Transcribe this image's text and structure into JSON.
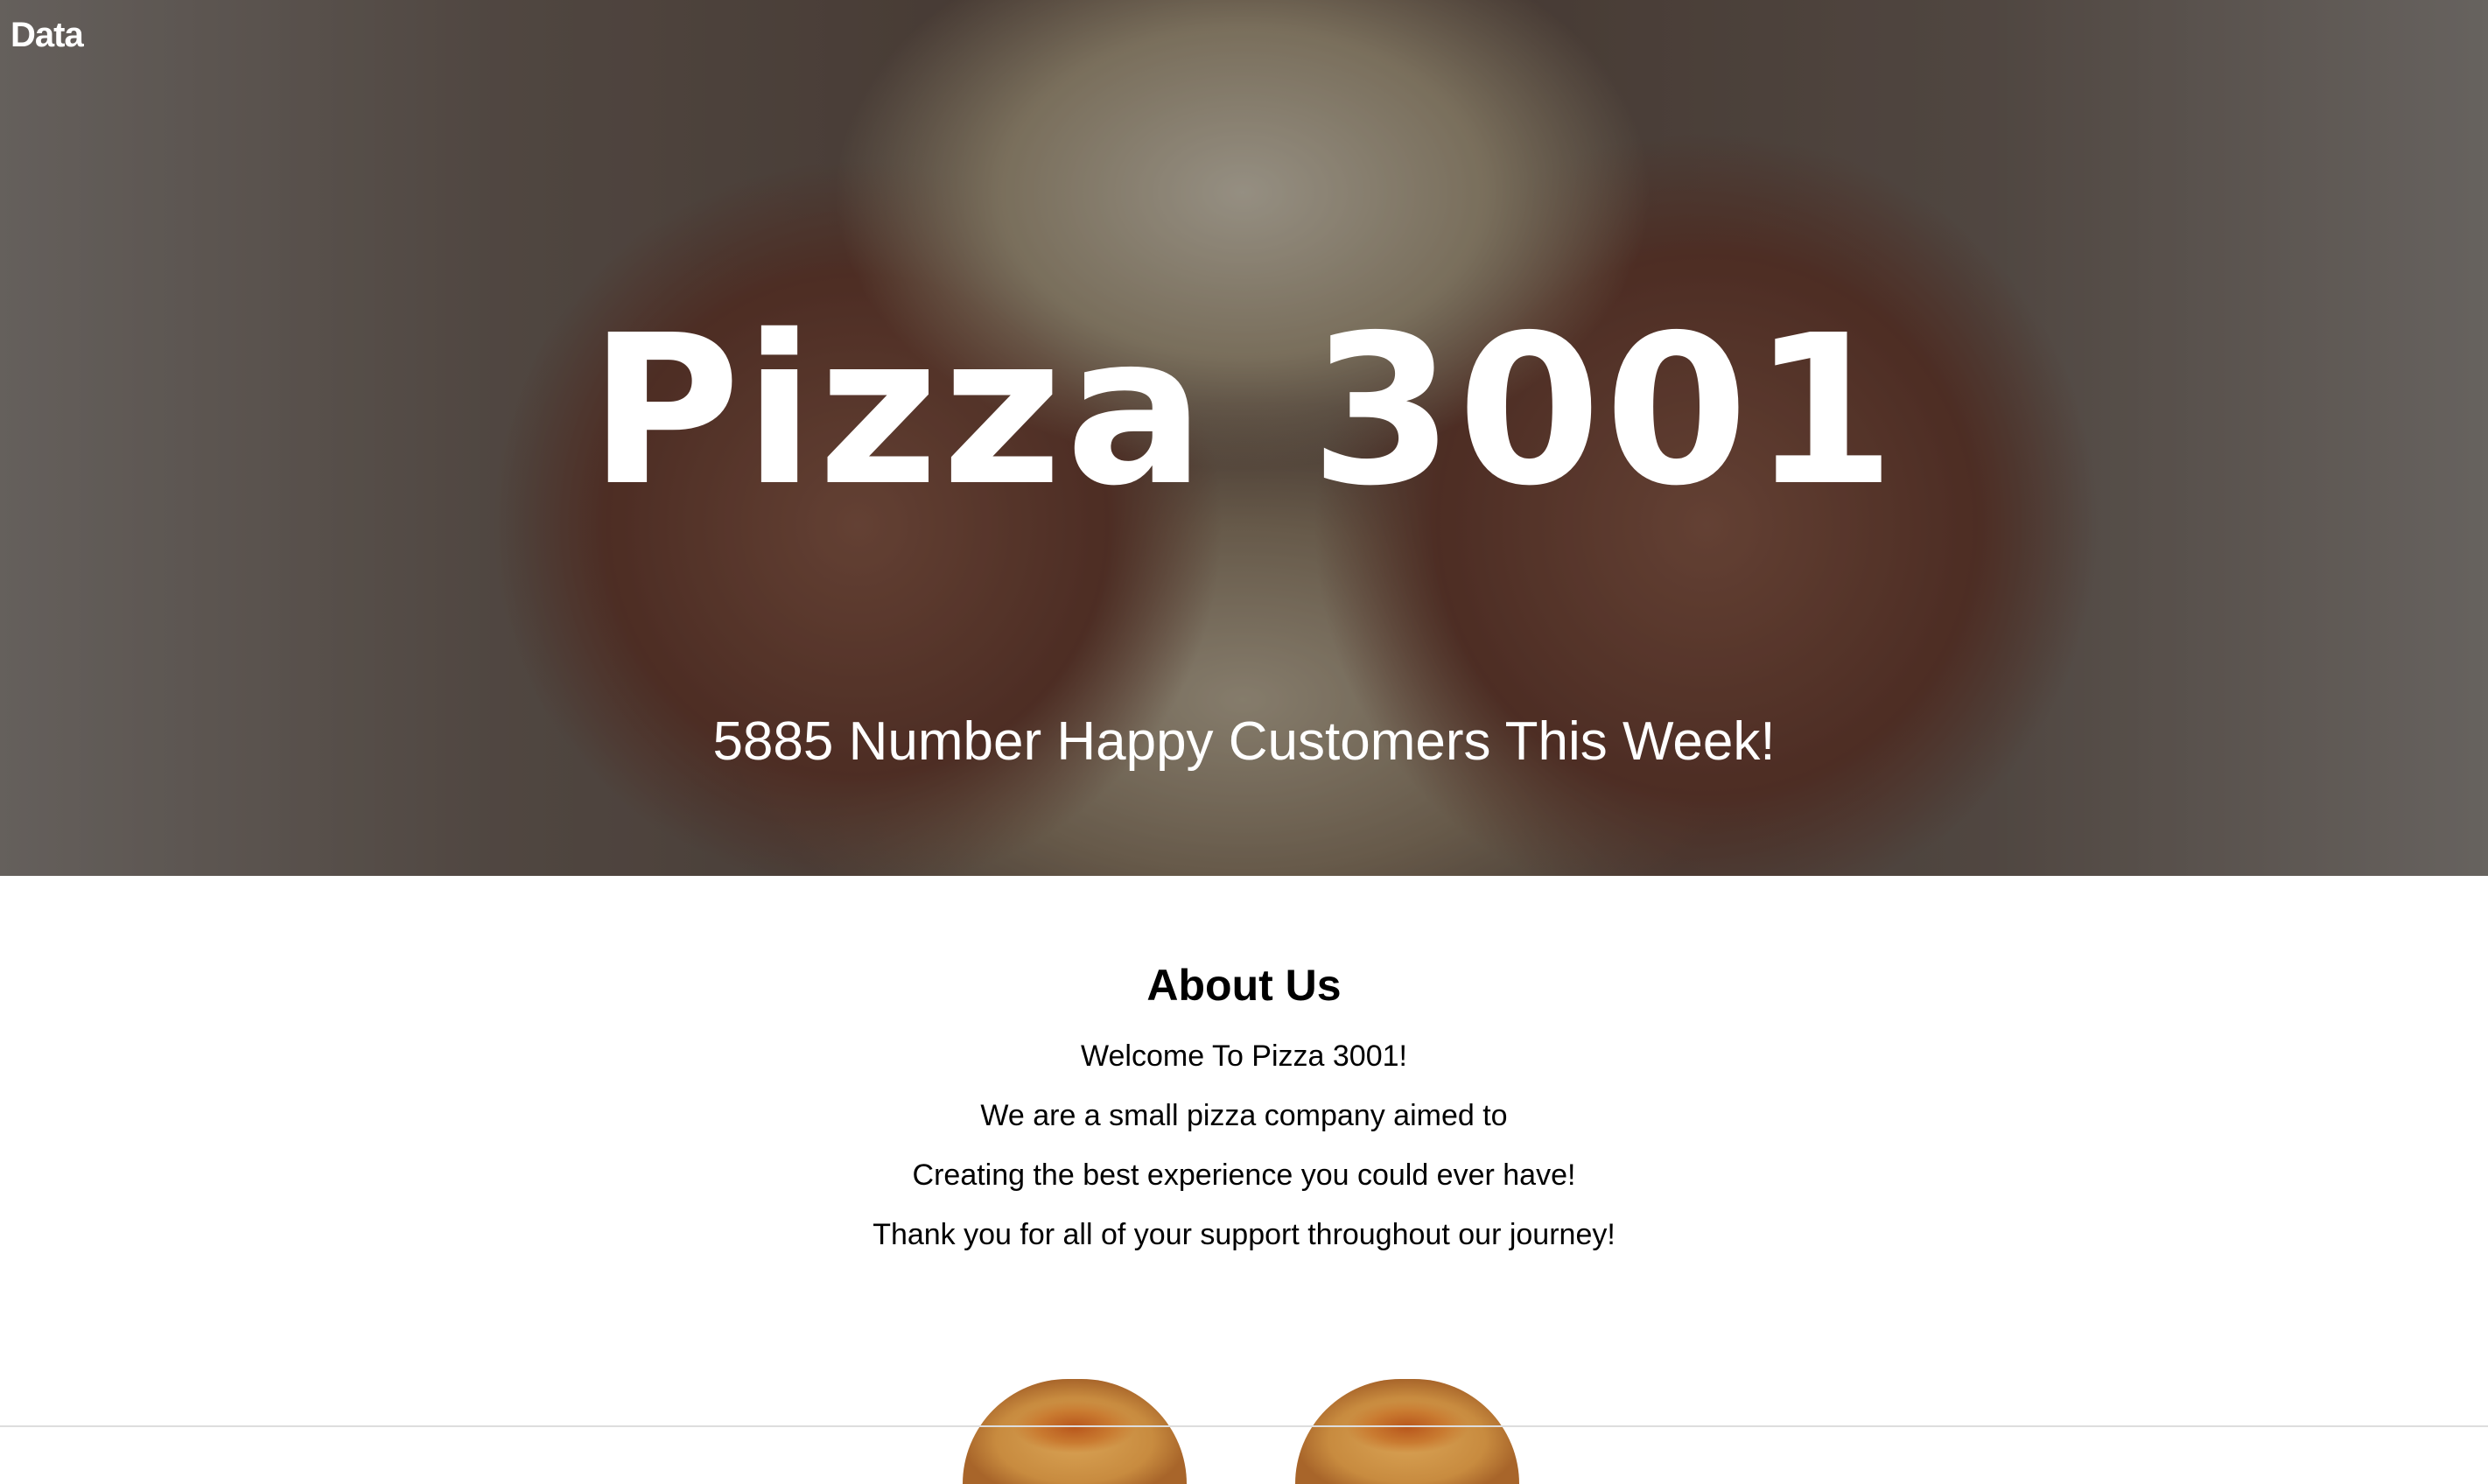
{
  "nav": {
    "brand": "Data"
  },
  "hero": {
    "title": "Pizza 3001",
    "subtitle": "5885 Number Happy Customers This Week!"
  },
  "about": {
    "heading": "About Us",
    "lines": [
      "Welcome To Pizza 3001!",
      "We are a small pizza company aimed to",
      "Creating the best experience you could ever have!",
      "Thank you for all of your support throughout our journey!"
    ]
  },
  "colors": {
    "hero_text": "#ffffff",
    "body_text": "#000000",
    "background": "#ffffff"
  },
  "images": {
    "hero": "dough-hands-image",
    "products": [
      "pizza-image",
      "pizza-image"
    ]
  }
}
